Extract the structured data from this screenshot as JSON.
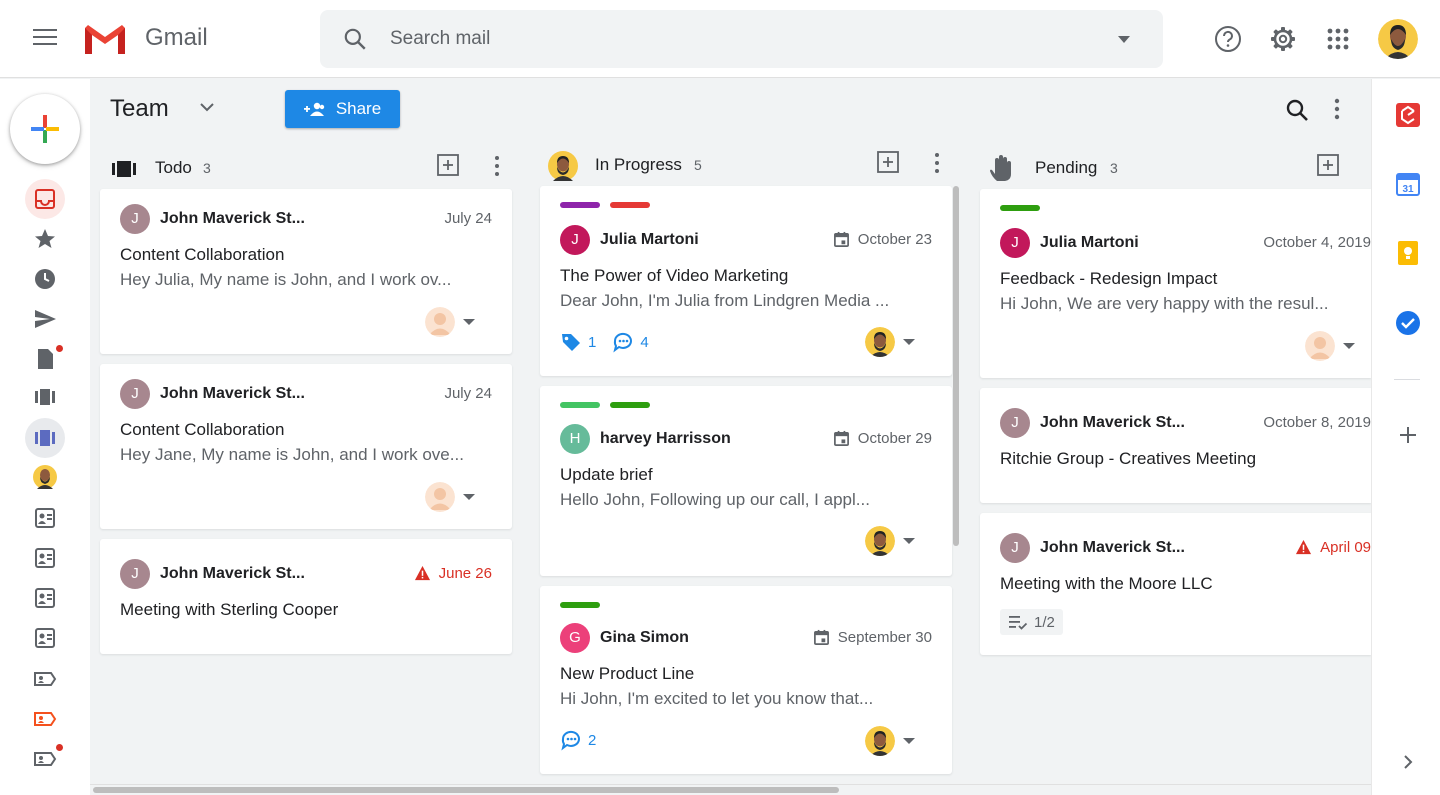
{
  "app": {
    "name": "Gmail"
  },
  "search": {
    "placeholder": "Search mail"
  },
  "board": {
    "title": "Team",
    "share_label": "Share"
  },
  "columns": [
    {
      "name": "Todo",
      "count": "3",
      "cards": [
        {
          "sender": "John Maverick St...",
          "initial": "J",
          "date": "July 24",
          "overdue": false,
          "subject": "Content Collaboration",
          "snippet": "Hey Julia, My name is John, and I work ov..."
        },
        {
          "sender": "John Maverick St...",
          "initial": "J",
          "date": "July 24",
          "overdue": false,
          "subject": "Content Collaboration",
          "snippet": "Hey Jane, My name is John, and I work ove..."
        },
        {
          "sender": "John Maverick St...",
          "initial": "J",
          "date": "June 26",
          "overdue": true,
          "subject": "Meeting with Sterling Cooper",
          "snippet": ""
        }
      ]
    },
    {
      "name": "In Progress",
      "count": "5",
      "cards": [
        {
          "sender": "Julia Martoni",
          "initial": "J",
          "date": "October 23",
          "overdue": false,
          "subject": "The Power of Video Marketing",
          "snippet": "Dear John, I'm Julia from Lindgren Media ...",
          "tags": "1",
          "comments": "4",
          "label_colors": [
            "#8e24aa",
            "#e53935"
          ]
        },
        {
          "sender": "harvey Harrisson",
          "initial": "H",
          "date": "October 29",
          "overdue": false,
          "subject": "Update brief",
          "snippet": "Hello John, Following up our call, I appl...",
          "label_colors": [
            "#43a047",
            "#2e9e0f"
          ]
        },
        {
          "sender": "Gina Simon",
          "initial": "G",
          "date": "September 30",
          "overdue": false,
          "subject": "New Product Line",
          "snippet": "Hi John, I'm excited to let you know that...",
          "comments": "2",
          "label_colors": [
            "#2e9e0f"
          ]
        }
      ]
    },
    {
      "name": "Pending",
      "count": "3",
      "cards": [
        {
          "sender": "Julia Martoni",
          "initial": "J",
          "date": "October 4, 2019",
          "overdue": false,
          "subject": "Feedback - Redesign Impact",
          "snippet": "Hi John, We are very happy with the resul...",
          "label_colors": [
            "#2e9e0f"
          ]
        },
        {
          "sender": "John Maverick St...",
          "initial": "J",
          "date": "October 8, 2019",
          "overdue": false,
          "subject": "Ritchie Group - Creatives Meeting",
          "snippet": ""
        },
        {
          "sender": "John Maverick St...",
          "initial": "J",
          "date": "April 09",
          "overdue": true,
          "subject": "Meeting with the Moore LLC",
          "snippet": "",
          "checklist": "1/2"
        }
      ]
    }
  ],
  "colors": {
    "accent": "#1e88e5",
    "overdue": "#d93025",
    "avatar_john": "#a7878f",
    "avatar_julia": "#c2185b",
    "avatar_harvey": "#66bb9a",
    "avatar_gina": "#ec407a"
  }
}
